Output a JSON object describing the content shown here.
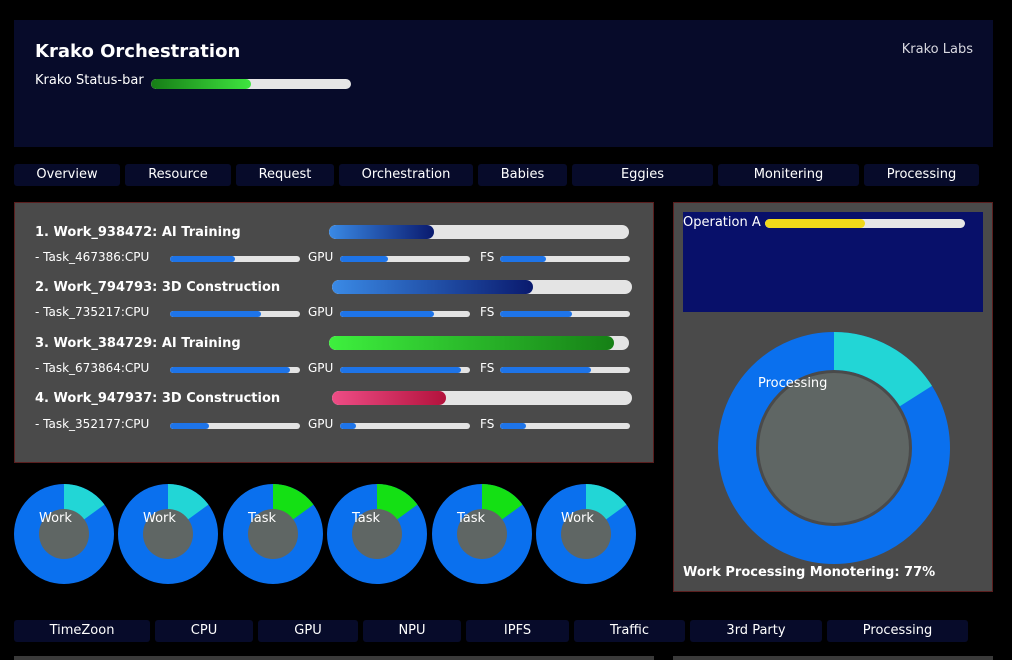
{
  "header": {
    "title": "Krako Orchestration",
    "brand": "Krako Labs",
    "status_label": "Krako Status-bar",
    "status_progress": 0.5
  },
  "nav_tabs": [
    "Overview",
    "Resource",
    "Request",
    "Orchestration",
    "Babies",
    "Eggies",
    "Monitering",
    "Processing"
  ],
  "works": [
    {
      "title": "1. Work_938472: AI Training",
      "progress": 0.35,
      "color": "blue",
      "task": "- Task_467386:CPU",
      "cpu": 0.5,
      "gpu": 0.37,
      "fs": 0.35
    },
    {
      "title": "2. Work_794793: 3D Construction",
      "progress": 0.67,
      "color": "blue",
      "task": "- Task_735217:CPU",
      "cpu": 0.7,
      "gpu": 0.72,
      "fs": 0.55
    },
    {
      "title": "3. Work_384729: AI Training",
      "progress": 0.95,
      "color": "green",
      "task": "- Task_673864:CPU",
      "cpu": 0.92,
      "gpu": 0.93,
      "fs": 0.7
    },
    {
      "title": "4. Work_947937: 3D Construction",
      "progress": 0.38,
      "color": "pink",
      "task": "- Task_352177:CPU",
      "cpu": 0.3,
      "gpu": 0.12,
      "fs": 0.2
    }
  ],
  "mini_labels": {
    "gpu": "GPU",
    "fs": "FS"
  },
  "operation": {
    "label": "Operation A",
    "progress": 0.5
  },
  "processing_donut": {
    "label": "Processing",
    "secondary_fraction": 0.16,
    "main_color": "#0a70ee",
    "secondary_color": "#22d6d6",
    "hole_color": "#5f6664"
  },
  "processing_footer": "Work Processing Monotering: 77%",
  "small_donuts": [
    {
      "label": "Work",
      "fraction": 0.15,
      "color": "#22d6d6"
    },
    {
      "label": "Work",
      "fraction": 0.15,
      "color": "#22d6d6"
    },
    {
      "label": "Task",
      "fraction": 0.15,
      "color": "#14e014"
    },
    {
      "label": "Task",
      "fraction": 0.15,
      "color": "#14e014"
    },
    {
      "label": "Task",
      "fraction": 0.15,
      "color": "#14e014"
    },
    {
      "label": "Work",
      "fraction": 0.15,
      "color": "#22d6d6"
    }
  ],
  "bottom_tabs": [
    "TimeZoon",
    "CPU",
    "GPU",
    "NPU",
    "IPFS",
    "Traffic",
    "3rd Party",
    "Processing"
  ],
  "colors": {
    "background": "#000000",
    "header_bg": "#070b2a",
    "panel_bg": "#4a4a4a",
    "accent_blue": "#1e74e8",
    "donut_blue": "#0a70ee"
  }
}
